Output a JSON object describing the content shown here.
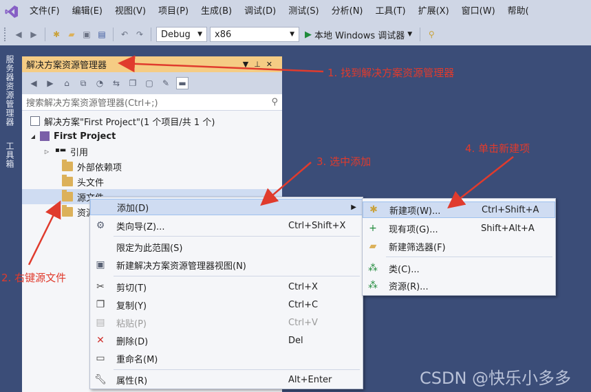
{
  "menubar": {
    "items": [
      "文件(F)",
      "编辑(E)",
      "视图(V)",
      "项目(P)",
      "生成(B)",
      "调试(D)",
      "测试(S)",
      "分析(N)",
      "工具(T)",
      "扩展(X)",
      "窗口(W)",
      "帮助("
    ]
  },
  "toolbar": {
    "config": "Debug",
    "platform": "x86",
    "run_label": "本地 Windows 调试器"
  },
  "sidebar_tabs": [
    "服务器资源管理器",
    "工具箱"
  ],
  "panel": {
    "title": "解决方案资源管理器",
    "search_placeholder": "搜索解决方案资源管理器(Ctrl+;)",
    "tree": [
      {
        "label": "解决方案\"First Project\"(1 个项目/共 1 个)"
      },
      {
        "label": "First Project"
      },
      {
        "label": "引用"
      },
      {
        "label": "外部依赖项"
      },
      {
        "label": "头文件"
      },
      {
        "label": "源文件"
      },
      {
        "label": "资源文件"
      }
    ]
  },
  "context_menu": {
    "items": [
      {
        "label": "添加(D)",
        "shortcut": "",
        "icon": "none"
      },
      {
        "label": "类向导(Z)...",
        "shortcut": "Ctrl+Shift+X",
        "icon": "class-wizard-icon"
      },
      {
        "label": "限定为此范围(S)",
        "shortcut": "",
        "icon": "none"
      },
      {
        "label": "新建解决方案资源管理器视图(N)",
        "shortcut": "",
        "icon": "new-view-icon"
      },
      {
        "label": "剪切(T)",
        "shortcut": "Ctrl+X",
        "icon": "scissors-icon"
      },
      {
        "label": "复制(Y)",
        "shortcut": "Ctrl+C",
        "icon": "copy-icon"
      },
      {
        "label": "粘贴(P)",
        "shortcut": "Ctrl+V",
        "icon": "paste-icon"
      },
      {
        "label": "删除(D)",
        "shortcut": "Del",
        "icon": "delete-icon"
      },
      {
        "label": "重命名(M)",
        "shortcut": "",
        "icon": "rename-icon"
      },
      {
        "label": "属性(R)",
        "shortcut": "Alt+Enter",
        "icon": "wrench-icon"
      }
    ]
  },
  "submenu": {
    "items": [
      {
        "label": "新建项(W)...",
        "shortcut": "Ctrl+Shift+A"
      },
      {
        "label": "现有项(G)...",
        "shortcut": "Shift+Alt+A"
      },
      {
        "label": "新建筛选器(F)",
        "shortcut": ""
      },
      {
        "label": "类(C)...",
        "shortcut": ""
      },
      {
        "label": "资源(R)...",
        "shortcut": ""
      }
    ]
  },
  "annotations": {
    "step1": "1. 找到解决方案资源管理器",
    "step2": "2. 右键源文件",
    "step3": "3. 选中添加",
    "step4": "4. 单击新建项"
  },
  "watermark": "CSDN @快乐小多多",
  "colors": {
    "background": "#3b4d78",
    "panel_title": "#f5cc84",
    "highlight": "#cfdcf2",
    "annotation": "#e03b2d",
    "vs_purple": "#865fc5"
  }
}
